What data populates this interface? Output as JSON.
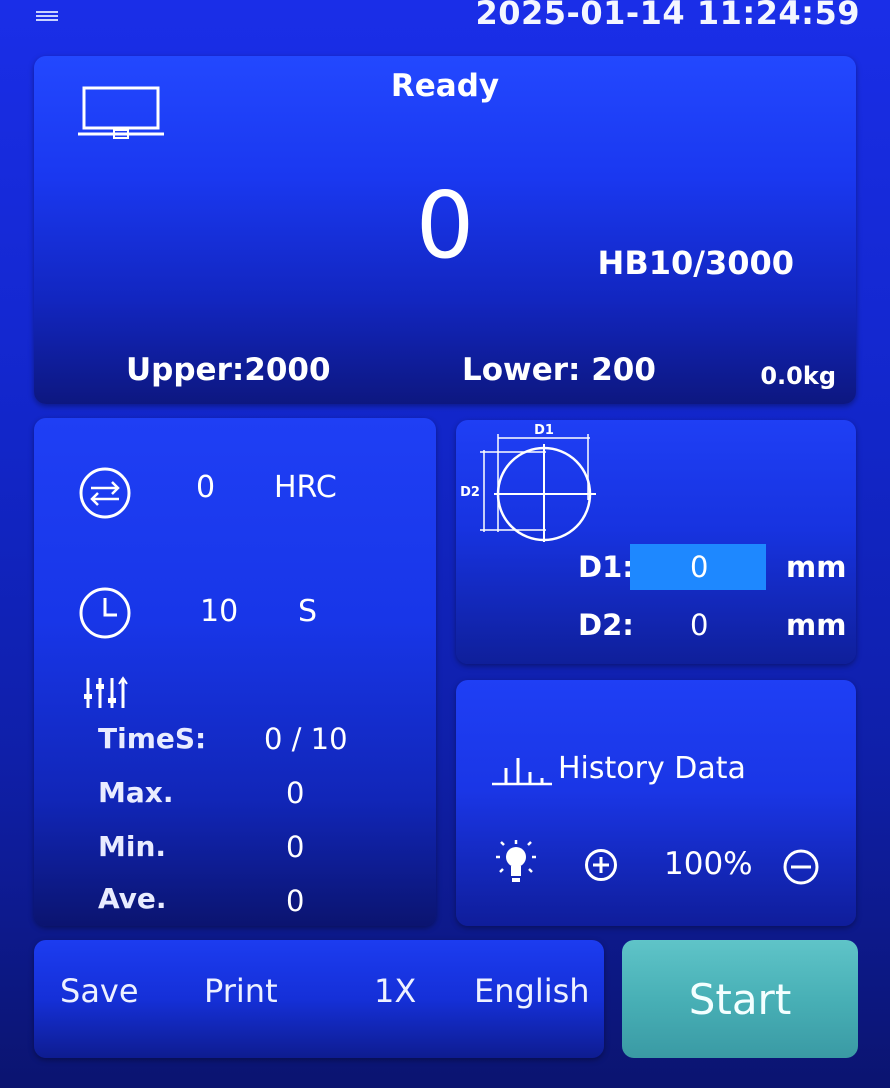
{
  "header": {
    "datetime": "2025-01-14 11:24:59",
    "menu_icon": "hamburger-menu-icon"
  },
  "measurement": {
    "status": "Ready",
    "value": "0",
    "scale": "HB10/3000",
    "upper": "Upper:2000",
    "lower": "Lower: 200",
    "load": "0.0kg",
    "device_icon": "laptop-icon"
  },
  "settings": {
    "conversion_value": "0",
    "conversion_unit": "HRC",
    "dwell_value": "10",
    "dwell_unit": "S",
    "stats_icon": "sliders-icon",
    "stats": [
      {
        "label": "TimeS:",
        "value": "0 / 10"
      },
      {
        "label": "Max.",
        "value": "0"
      },
      {
        "label": "Min.",
        "value": "0"
      },
      {
        "label": "Ave.",
        "value": "0"
      }
    ]
  },
  "indentation": {
    "diagram_d1": "D1",
    "diagram_d2": "D2",
    "d1_label": "D1:",
    "d1_value": "0",
    "d1_unit": "mm",
    "d2_label": "D2:",
    "d2_value": "0",
    "d2_unit": "mm"
  },
  "tools": {
    "history_label": "History Data",
    "zoom": "100%"
  },
  "toolbar": {
    "save": "Save",
    "print": "Print",
    "speed": "1X",
    "language": "English",
    "start": "Start"
  },
  "colors": {
    "background": "#1226c9",
    "input_highlight": "#1e88ff",
    "start_button": "#48b0b6"
  }
}
